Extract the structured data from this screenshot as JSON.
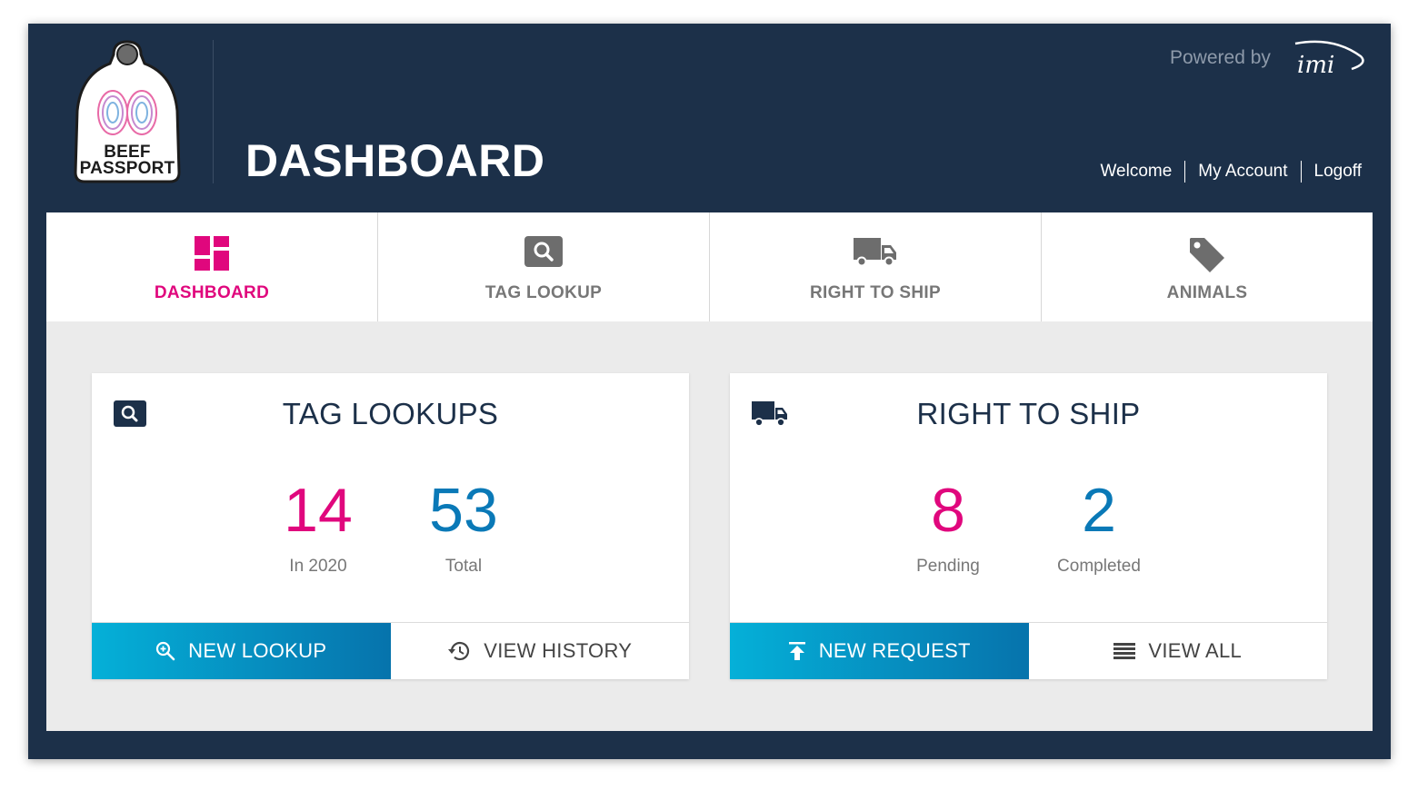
{
  "header": {
    "logo_text_line1": "BEEF",
    "logo_text_line2": "PASSPORT",
    "page_title": "DASHBOARD",
    "powered_by": "Powered by",
    "powered_logo_text": "imi",
    "user_links": [
      "Welcome",
      "My Account",
      "Logoff"
    ]
  },
  "tabs": [
    {
      "label": "DASHBOARD",
      "icon": "dashboard-icon",
      "active": true
    },
    {
      "label": "TAG LOOKUP",
      "icon": "search-icon",
      "active": false
    },
    {
      "label": "RIGHT TO SHIP",
      "icon": "truck-icon",
      "active": false
    },
    {
      "label": "ANIMALS",
      "icon": "tag-icon",
      "active": false
    }
  ],
  "cards": {
    "tag_lookups": {
      "title": "TAG LOOKUPS",
      "icon": "search-icon",
      "stats": [
        {
          "value": "14",
          "label": "In 2020"
        },
        {
          "value": "53",
          "label": "Total"
        }
      ],
      "primary_action": "NEW LOOKUP",
      "primary_icon": "zoom-in-icon",
      "secondary_action": "VIEW HISTORY",
      "secondary_icon": "history-icon"
    },
    "right_to_ship": {
      "title": "RIGHT TO SHIP",
      "icon": "truck-icon",
      "stats": [
        {
          "value": "8",
          "label": "Pending"
        },
        {
          "value": "2",
          "label": "Completed"
        }
      ],
      "primary_action": "NEW REQUEST",
      "primary_icon": "upload-icon",
      "secondary_action": "VIEW ALL",
      "secondary_icon": "list-icon"
    }
  },
  "colors": {
    "header_bg": "#1c3049",
    "accent_pink": "#e0077d",
    "accent_blue": "#0a79b7",
    "button_gradient_start": "#05b0d8",
    "button_gradient_end": "#0673ac"
  }
}
